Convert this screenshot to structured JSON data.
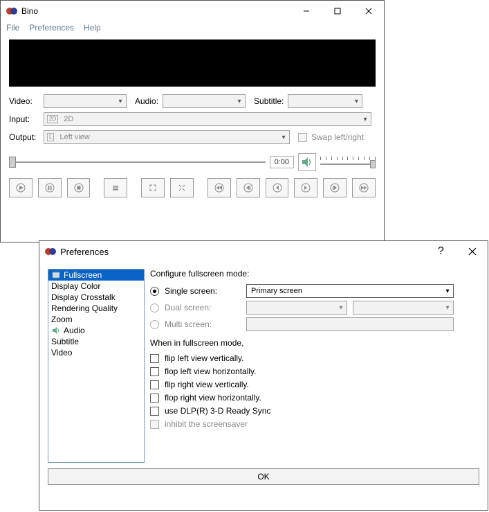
{
  "app": {
    "title": "Bino",
    "menu": {
      "file": "File",
      "preferences": "Preferences",
      "help": "Help"
    }
  },
  "selectors": {
    "video_label": "Video:",
    "audio_label": "Audio:",
    "subtitle_label": "Subtitle:",
    "input_label": "Input:",
    "input_badge": "2D",
    "input_value": "2D",
    "output_label": "Output:",
    "output_badge": "L",
    "output_value": "Left view",
    "swap_label": "Swap left/right"
  },
  "playback": {
    "time": "0:00"
  },
  "prefs": {
    "title": "Preferences",
    "categories": [
      "Fullscreen",
      "Display Color",
      "Display Crosstalk",
      "Rendering Quality",
      "Zoom",
      "Audio",
      "Subtitle",
      "Video"
    ],
    "configure_label": "Configure fullscreen mode:",
    "single_screen": "Single screen:",
    "dual_screen": "Dual screen:",
    "multi_screen": "Multi screen:",
    "primary_screen": "Primary screen",
    "when_label": "When in fullscreen mode,",
    "checks": [
      "flip left view vertically.",
      "flop left view horizontally.",
      "flip right view vertically.",
      "flop right view horizontally.",
      "use DLP(R) 3-D Ready Sync",
      "inhibit the screensaver"
    ],
    "ok": "OK"
  }
}
